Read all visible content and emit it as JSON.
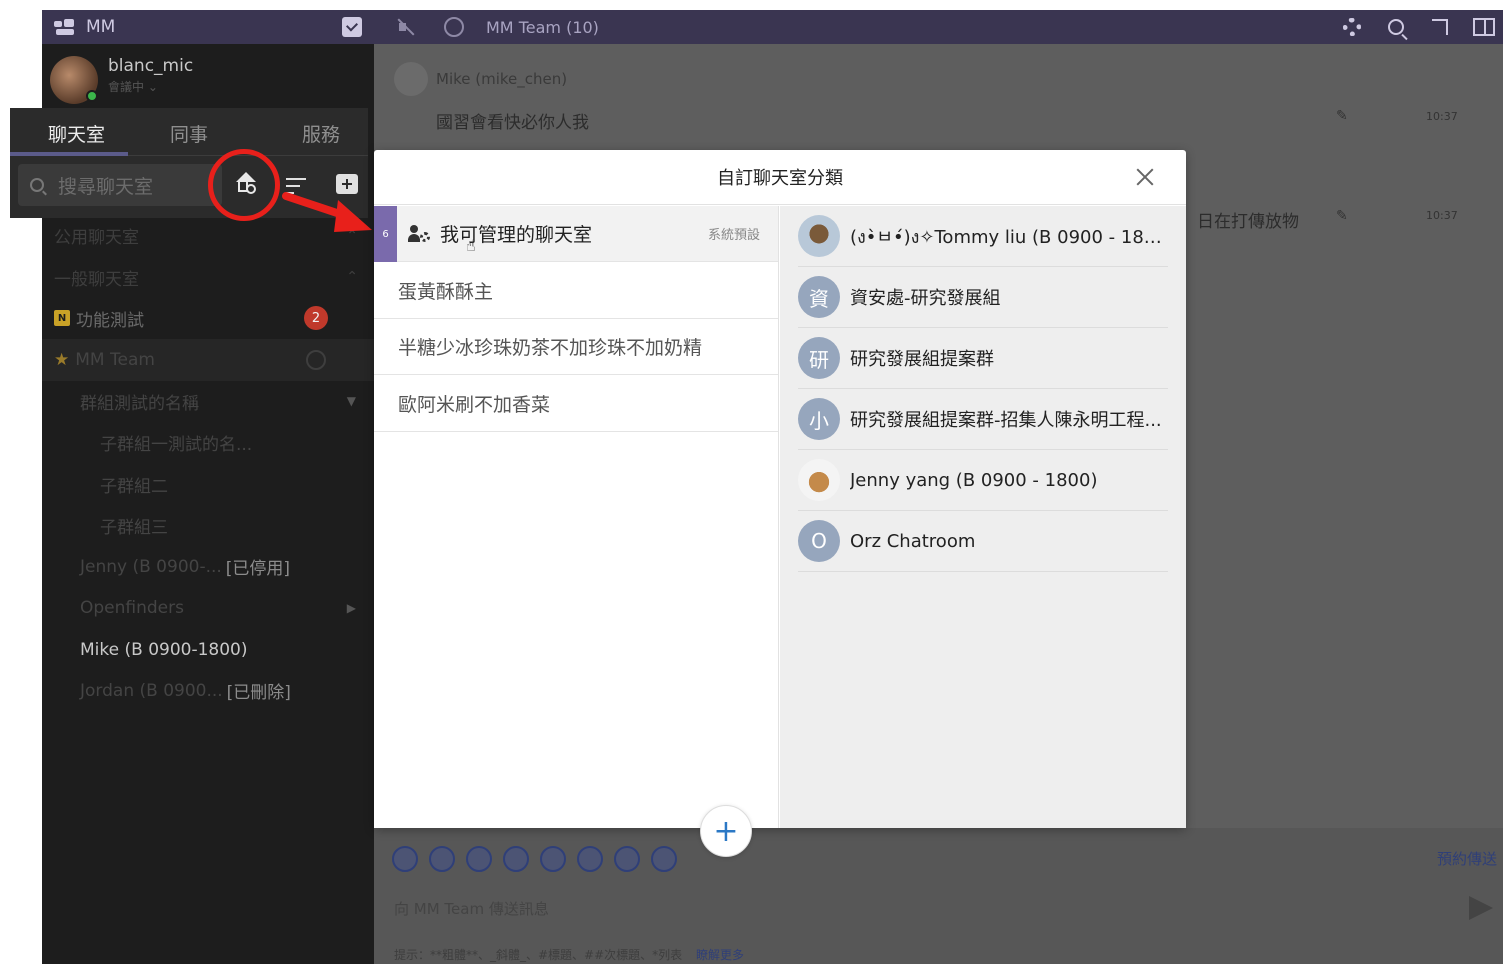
{
  "app": {
    "title": "MM",
    "user_name": "blanc_mic",
    "user_status": "會議中 ⌄"
  },
  "sidebar": {
    "tabs": [
      "聊天室",
      "同事",
      "服務"
    ],
    "search_placeholder": "搜尋聊天室",
    "rooms": [
      {
        "label": "公用聊天室"
      },
      {
        "label": "一般聊天室"
      },
      {
        "label": "功能測試",
        "badge": "2",
        "tag": "N"
      },
      {
        "label": "MM Team"
      },
      {
        "label": "群組測試的名稱"
      },
      {
        "label": "子群組一測試的名..."
      },
      {
        "label": "子群組二"
      },
      {
        "label": "子群組三"
      },
      {
        "label": "Jenny (B 0900-...",
        "suffix": "[已停用]"
      },
      {
        "label": "Openfinders"
      },
      {
        "label": "Mike (B 0900-1800)"
      },
      {
        "label": "Jordan (B 0900...",
        "suffix": "[已刪除]"
      }
    ]
  },
  "channel": {
    "title": "MM Team (10)"
  },
  "messages": [
    {
      "sender": "Mike (mike_chen)",
      "text": "國習會看快必你人我",
      "time": "10:37"
    },
    {
      "text": "，日在打傳放物",
      "time": "10:37"
    }
  ],
  "compose": {
    "placeholder": "向 MM Team 傳送訊息",
    "schedule_label": "預約傳送",
    "hint": "提示：**粗體**、_斜體_、#標題、##次標題、*列表",
    "learn_more": "瞭解更多"
  },
  "modal": {
    "title": "自訂聊天室分類",
    "categories": [
      {
        "label": "我可管理的聊天室",
        "count": "6",
        "default_tag": "系統預設"
      },
      {
        "label": "蛋黃酥酥主"
      },
      {
        "label": "半糖少冰珍珠奶茶不加珍珠不加奶精"
      },
      {
        "label": "歐阿米刷不加香菜"
      }
    ],
    "rooms": [
      {
        "name": "(ง•̀ㅂ•́)ง✧Tommy liu (B 0900 - 1800)",
        "avatar": ""
      },
      {
        "name": "資安處-研究發展組",
        "avatar": "資"
      },
      {
        "name": "研究發展組提案群",
        "avatar": "研"
      },
      {
        "name": "研究發展組提案群-招集人陳永明工程...",
        "avatar": "小"
      },
      {
        "name": "Jenny yang (B 0900 - 1800)",
        "avatar": ""
      },
      {
        "name": "Orz Chatroom",
        "avatar": "O"
      }
    ]
  },
  "colors": {
    "header_bg": "#3a3551",
    "accent": "#7a6aac",
    "highlight": "#e8201b",
    "link": "#2b78c5"
  }
}
